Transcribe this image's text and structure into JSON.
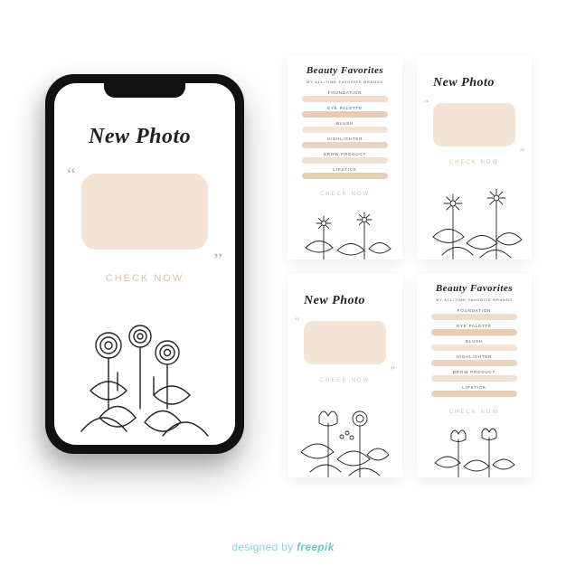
{
  "colors": {
    "peach": "#f3e4d5",
    "cta_text": "#dcc2a6",
    "teal": "#8cd4d6"
  },
  "new_photo": {
    "title": "New Photo",
    "cta": "CHECK NOW"
  },
  "beauty_favorites": {
    "title": "Beauty Favorites",
    "subtitle": "MY ALL-TIME FAVORITE BRANDS",
    "items": [
      {
        "label": "FOUNDATION",
        "color": "#efdccb"
      },
      {
        "label": "EYE PALETTE",
        "color": "#e8cdb4"
      },
      {
        "label": "BLUSH",
        "color": "#f3e4d5"
      },
      {
        "label": "HIGHLIGHTER",
        "color": "#ead4bf"
      },
      {
        "label": "BROW PRODUCT",
        "color": "#f0e1d2"
      },
      {
        "label": "LIPSTICK",
        "color": "#e9cfb7"
      }
    ],
    "cta": "CHECK NOW"
  },
  "attribution": {
    "prefix": "designed by ",
    "brand": "freepik"
  },
  "floral_variants": [
    "roses",
    "daisies",
    "mixed",
    "tulips"
  ]
}
